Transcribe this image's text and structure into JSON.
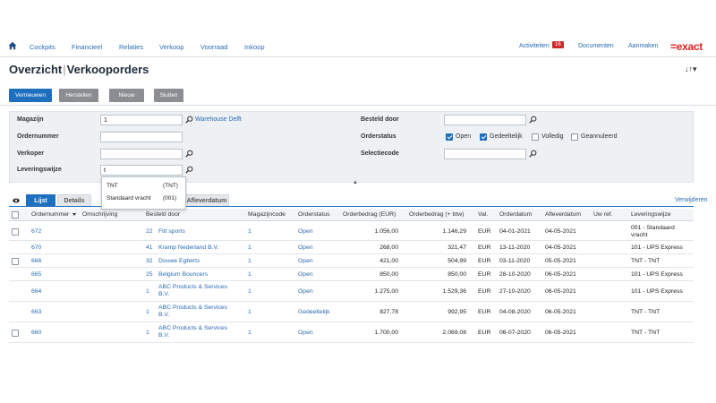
{
  "nav": {
    "items": [
      "Cockpits",
      "Financieel",
      "Relaties",
      "Verkoop",
      "Voorraad",
      "Inkoop"
    ],
    "activiteiten_label": "Activiteiten",
    "activiteiten_count": "16",
    "documenten_label": "Documenten",
    "aanmaken_label": "Aanmaken",
    "logo_text": "=exact",
    "brand_color": "#e02020",
    "accent_color": "#1f6fbf"
  },
  "page": {
    "title_part1": "Overzicht",
    "title_part2": "Verkooporders",
    "sort_icon": "sort-icon"
  },
  "toolbar": {
    "vernieuwen": "Vernieuwen",
    "herstellen": "Herstellen",
    "nieuw": "Nieuw",
    "sluiten": "Sluiten"
  },
  "filters": {
    "magazijn_label": "Magazijn",
    "magazijn_value": "1",
    "magazijn_link": "Warehouse Delft",
    "ordernummer_label": "Ordernummer",
    "ordernummer_value": "",
    "verkoper_label": "Verkoper",
    "verkoper_value": "",
    "leveringswijze_label": "Leveringswijze",
    "leveringswijze_value": "t",
    "besteld_door_label": "Besteld door",
    "besteld_door_value": "",
    "orderstatus_label": "Orderstatus",
    "status_open": "Open",
    "status_gedeeltelijk": "Gedeeltelijk",
    "status_volledig": "Volledig",
    "status_geannuleerd": "Geannuleerd",
    "selectiecode_label": "Selectiecode",
    "selectiecode_value": ""
  },
  "dropdown": {
    "options": [
      {
        "name": "TNT",
        "code": "(TNT)"
      },
      {
        "name": "Standaard vracht",
        "code": "(001)"
      }
    ]
  },
  "tabs": {
    "lijst": "Lijst",
    "details": "Details",
    "afleverdatum": "Afleverdatum",
    "verwijderen": "Verwijderen"
  },
  "table": {
    "headers": [
      "Ordernummer",
      "Omschrijving",
      "Besteld door",
      "Magazijncode",
      "Orderstatus",
      "Orderbedrag (EUR)",
      "Orderbedrag (+ btw)",
      "Val.",
      "Orderdatum",
      "Afleverdatum",
      "Uw ref.",
      "Leveringswijze"
    ],
    "rows": [
      {
        "nr": "672",
        "cust_no": "22",
        "cust": "Fitt sports",
        "mag": "1",
        "status": "Open",
        "eur": "1.056,00",
        "btw": "1.146,29",
        "val": "EUR",
        "odate": "04-01-2021",
        "adate": "04-05-2021",
        "ref": "",
        "lev": "001 - Standaard vracht"
      },
      {
        "nr": "670",
        "cust_no": "41",
        "cust": "Kramp Nederland B.V.",
        "mag": "1",
        "status": "Open",
        "eur": "268,00",
        "btw": "321,47",
        "val": "EUR",
        "odate": "13-11-2020",
        "adate": "04-05-2021",
        "ref": "",
        "lev": "101 - UPS Express"
      },
      {
        "nr": "666",
        "cust_no": "32",
        "cust": "Douwe Egberts",
        "mag": "1",
        "status": "Open",
        "eur": "421,00",
        "btw": "504,99",
        "val": "EUR",
        "odate": "03-11-2020",
        "adate": "05-05-2021",
        "ref": "",
        "lev": "TNT - TNT"
      },
      {
        "nr": "665",
        "cust_no": "25",
        "cust": "Belgium Bouncers",
        "mag": "1",
        "status": "Open",
        "eur": "850,00",
        "btw": "850,00",
        "val": "EUR",
        "odate": "28-10-2020",
        "adate": "06-05-2021",
        "ref": "",
        "lev": "101 - UPS Express"
      },
      {
        "nr": "664",
        "cust_no": "1",
        "cust": "ABC Products & Services B.V.",
        "mag": "1",
        "status": "Open",
        "eur": "1.275,00",
        "btw": "1.529,36",
        "val": "EUR",
        "odate": "27-10-2020",
        "adate": "06-05-2021",
        "ref": "",
        "lev": "101 - UPS Express"
      },
      {
        "nr": "663",
        "cust_no": "1",
        "cust": "ABC Products & Services B.V.",
        "mag": "1",
        "status": "Gedeeltelijk",
        "eur": "827,78",
        "btw": "992,95",
        "val": "EUR",
        "odate": "04-08-2020",
        "adate": "06-05-2021",
        "ref": "",
        "lev": "TNT - TNT"
      },
      {
        "nr": "660",
        "cust_no": "1",
        "cust": "ABC Products & Services B.V.",
        "mag": "1",
        "status": "Open",
        "eur": "1.700,00",
        "btw": "2.069,08",
        "val": "EUR",
        "odate": "06-07-2020",
        "adate": "06-05-2021",
        "ref": "",
        "lev": "TNT - TNT"
      }
    ]
  }
}
